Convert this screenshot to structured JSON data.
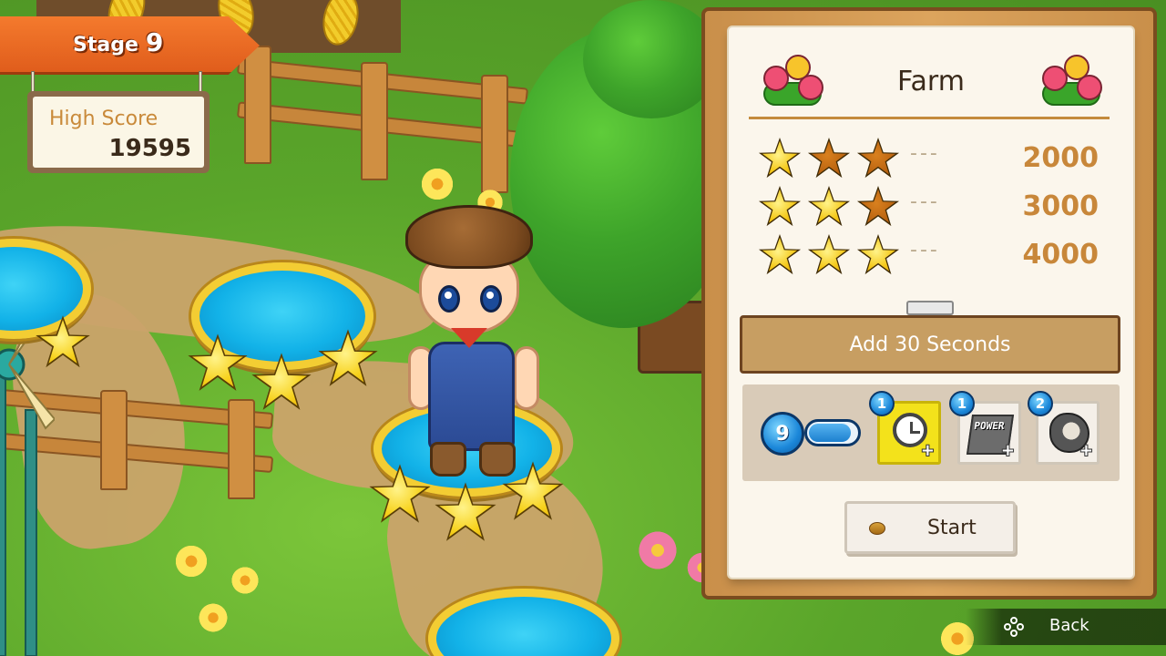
{
  "stage": {
    "label": "Stage",
    "number": "9"
  },
  "high_score": {
    "label": "High Score",
    "value": "19595"
  },
  "panel": {
    "title": "Farm",
    "score_rows": [
      {
        "stars_earned": 1,
        "stars_total": 3,
        "dashes": "---",
        "points": "2000"
      },
      {
        "stars_earned": 2,
        "stars_total": 3,
        "dashes": "---",
        "points": "3000"
      },
      {
        "stars_earned": 3,
        "stars_total": 3,
        "dashes": "---",
        "points": "4000"
      }
    ],
    "bonus_label": "Add 30 Seconds",
    "lives": {
      "count": "9",
      "level": 0.9
    },
    "items": [
      {
        "icon": "alarm-clock-icon",
        "badge": "1",
        "plus": "+",
        "selected": true
      },
      {
        "icon": "power-card-icon",
        "badge": "1",
        "plus": "+",
        "label": "POWER",
        "selected": false
      },
      {
        "icon": "bird-icon",
        "badge": "2",
        "plus": "+",
        "selected": false
      }
    ],
    "start_label": "Start"
  },
  "footer": {
    "back_label": "Back",
    "back_icon": "controller-face-buttons-icon"
  },
  "colors": {
    "stage_banner": "#e9661f",
    "star_on": "#f5c91a",
    "star_off": "#b5600f",
    "target_text": "#c8873a",
    "item_selected": "#f3e21b"
  }
}
